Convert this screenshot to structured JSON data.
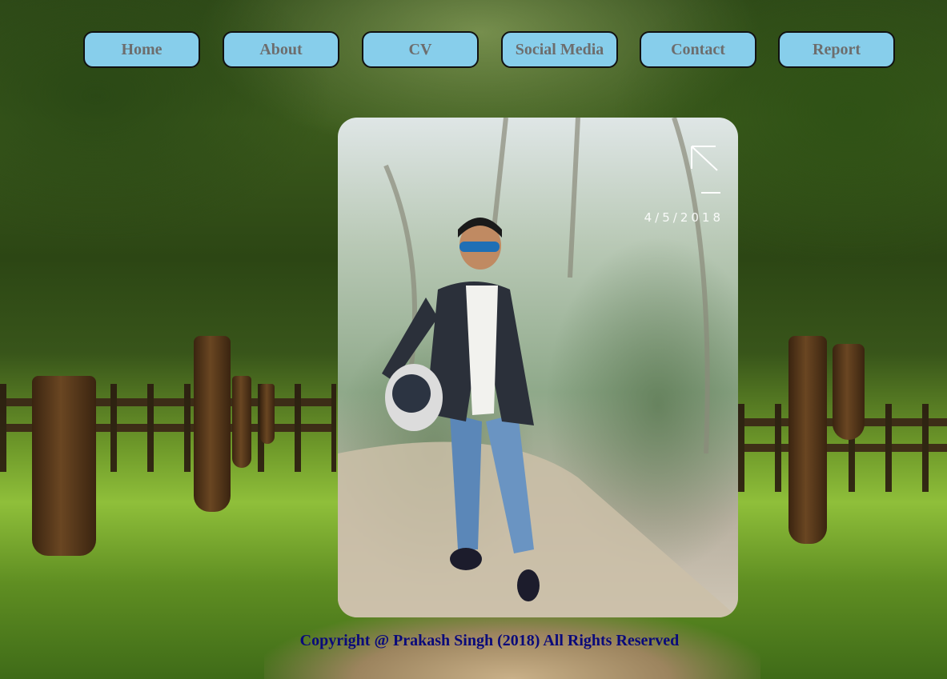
{
  "nav": {
    "items": [
      {
        "label": "Home"
      },
      {
        "label": "About"
      },
      {
        "label": "CV"
      },
      {
        "label": "Social Media"
      },
      {
        "label": "Contact"
      },
      {
        "label": "Report"
      }
    ]
  },
  "photo": {
    "date_stamp": "4/5/2018"
  },
  "footer": {
    "text": "Copyright @ Prakash Singh (2018) All Rights Reserved"
  },
  "colors": {
    "nav_button_bg": "#87ceeb",
    "nav_button_text": "#6d6d6d",
    "footer_text": "#0a0a7a"
  }
}
